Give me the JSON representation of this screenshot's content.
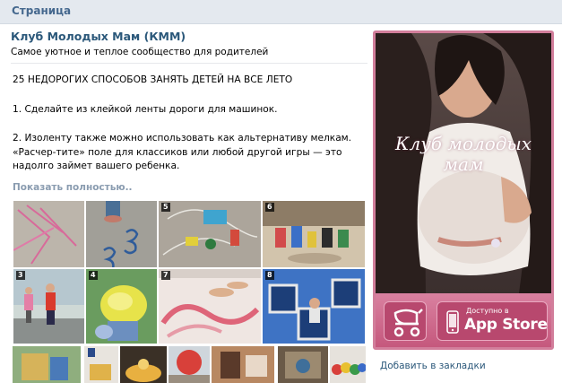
{
  "header": {
    "title": "Страница"
  },
  "group": {
    "name": "Клуб Молодых Мам (КММ)",
    "description": "Самое уютное и теплое сообщество для родителей"
  },
  "post": {
    "headline": "25 НЕДОРОГИХ СПОСОБОВ ЗАНЯТЬ ДЕТЕЙ НА ВСЕ ЛЕТО",
    "item1": "1. Сделайте из клейкой ленты дороги для машинок.",
    "item2": "2. Изоленту также можно использовать как альтернативу мелкам. «Расчер-тите» поле для классиков или любой другой игры — это надолго займет вашего ребенка.",
    "show_more": "Показать полностью..",
    "tile_numbers": [
      "3",
      "4",
      "5",
      "6",
      "7",
      "8"
    ]
  },
  "ad": {
    "logo_line1": "Клуб молодых",
    "logo_line2": "мам",
    "store_small": "Доступно в",
    "store_big": "App Store",
    "icons": [
      "stroller-icon",
      "phone-icon"
    ]
  },
  "sidebar": {
    "bookmark_label": "Добавить в закладки"
  },
  "colors": {
    "link": "#2b587a",
    "header_bg": "#e4e9ef",
    "ad_frame": "#d27e9b",
    "muted_link": "#8a9cb0"
  }
}
